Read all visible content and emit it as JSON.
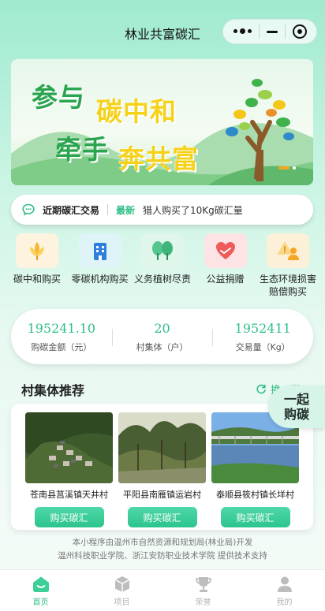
{
  "header": {
    "title": "林业共富碳汇"
  },
  "banner": {
    "line1_a": "参与",
    "line1_b": "碳中和",
    "line2_a": "牵手",
    "line2_b": "奔共富"
  },
  "ticker": {
    "label": "近期碳汇交易",
    "latest": "最新",
    "message": "猎人购买了10Kg碳汇量"
  },
  "categories": [
    {
      "label": "碳中和购买",
      "icon": "wheat-icon"
    },
    {
      "label": "零碳机构购买",
      "icon": "building-icon"
    },
    {
      "label": "义务植树尽责",
      "icon": "trees-icon"
    },
    {
      "label": "公益捐赠",
      "icon": "heart-hand-icon"
    },
    {
      "label": "生态环境损害赔偿购买",
      "icon": "person-warning-icon"
    }
  ],
  "stats": [
    {
      "value": "195241.10",
      "label": "购碳金额（元）"
    },
    {
      "value": "20",
      "label": "村集体（户）"
    },
    {
      "value": "1952411",
      "label": "交易量（Kg）"
    }
  ],
  "villages": {
    "title": "村集体推荐",
    "refresh_label": "换一批",
    "buy_label": "购买碳汇",
    "items": [
      {
        "name": "苍南县莒溪镇天井村"
      },
      {
        "name": "平阳县南雁镇运岩村"
      },
      {
        "name": "泰顺县筱村镇长垟村"
      }
    ]
  },
  "float_button": {
    "line1": "一起",
    "line2": "购碳"
  },
  "footer": {
    "line1": "本小程序由温州市自然资源和规划局(林业局)开发",
    "line2": "温州科技职业学院、浙江安防职业技术学院 提供技术支持"
  },
  "tabbar": [
    {
      "label": "首页",
      "icon": "home-icon",
      "active": true
    },
    {
      "label": "项目",
      "icon": "box-icon",
      "active": false
    },
    {
      "label": "荣誉",
      "icon": "trophy-icon",
      "active": false
    },
    {
      "label": "我的",
      "icon": "user-icon",
      "active": false
    }
  ],
  "colors": {
    "accent": "#2fbf85",
    "banner_green": "#2aa44f",
    "banner_yellow": "#f5d21a"
  }
}
